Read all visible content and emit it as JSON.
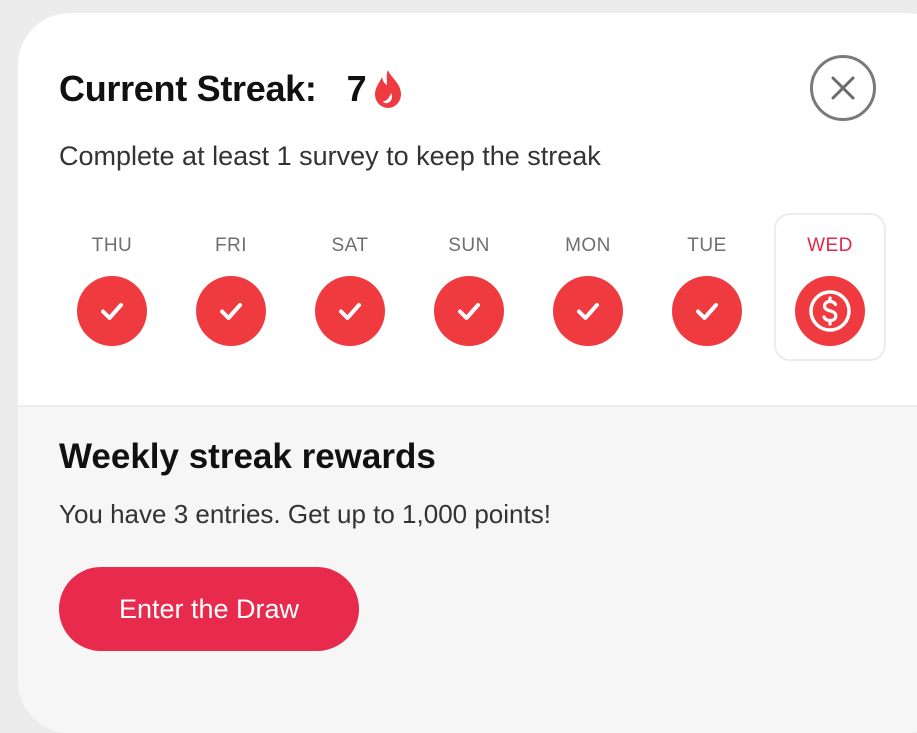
{
  "streak": {
    "title": "Current Streak:",
    "count": "7",
    "icon": "flame-icon",
    "subtitle": "Complete at least 1 survey to keep the streak"
  },
  "close": {
    "icon": "close-icon"
  },
  "days": [
    {
      "label": "THU",
      "status": "completed",
      "icon": "check-icon"
    },
    {
      "label": "FRI",
      "status": "completed",
      "icon": "check-icon"
    },
    {
      "label": "SAT",
      "status": "completed",
      "icon": "check-icon"
    },
    {
      "label": "SUN",
      "status": "completed",
      "icon": "check-icon"
    },
    {
      "label": "MON",
      "status": "completed",
      "icon": "check-icon"
    },
    {
      "label": "TUE",
      "status": "completed",
      "icon": "check-icon"
    },
    {
      "label": "WED",
      "status": "today",
      "icon": "dollar-coin-icon"
    }
  ],
  "rewards": {
    "title": "Weekly streak rewards",
    "subtitle": "You have 3 entries. Get up to 1,000 points!",
    "button_label": "Enter the Draw"
  },
  "colors": {
    "accent": "#e82a4d",
    "circle": "#ef3b3f",
    "today_label": "#e6284a"
  }
}
